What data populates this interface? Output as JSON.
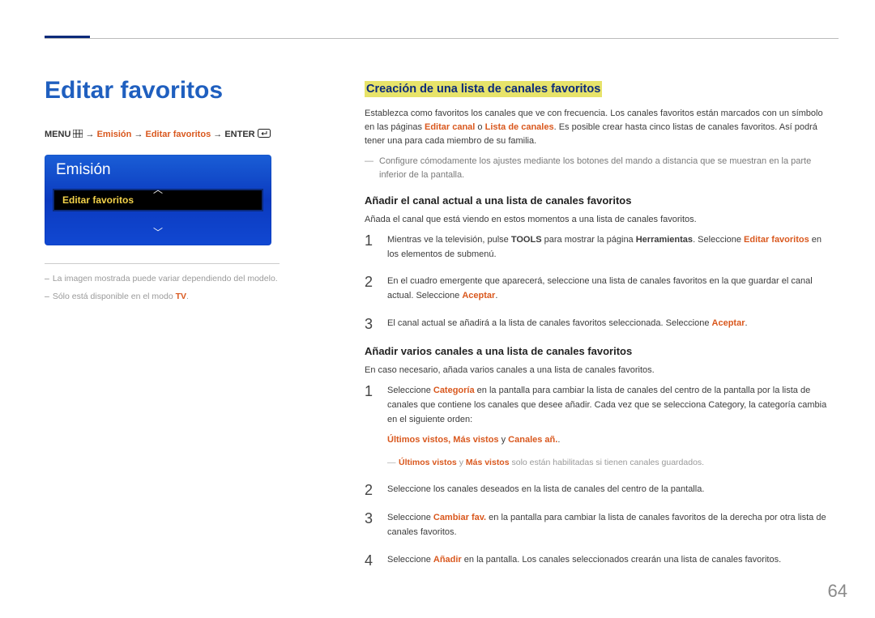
{
  "page_number": "64",
  "left": {
    "title": "Editar favoritos",
    "breadcrumb": {
      "menu": "MENU",
      "arrow": "→",
      "part1": "Emisión",
      "part2": "Editar favoritos",
      "enter": "ENTER"
    },
    "panel": {
      "header": "Emisión",
      "selected": "Editar favoritos"
    },
    "footnotes": [
      {
        "text": "La imagen mostrada puede variar dependiendo del modelo."
      },
      {
        "pre": "Sólo está disponible en el modo ",
        "hl": "TV",
        "post": "."
      }
    ]
  },
  "right": {
    "section_title": "Creación de una lista de canales favoritos",
    "intro": {
      "pre": "Establezca como favoritos los canales que ve con frecuencia. Los canales favoritos están marcados con un símbolo en las páginas ",
      "hl1": "Editar canal",
      "mid1": " o ",
      "hl2": "Lista de canales",
      "post": ". Es posible crear hasta cinco listas de canales favoritos. Así podrá tener una para cada miembro de su familia."
    },
    "tip1": "Configure cómodamente los ajustes mediante los botones del mando a distancia que se muestran en la parte inferior de la pantalla.",
    "sub1": {
      "title": "Añadir el canal actual a una lista de canales favoritos",
      "lead": "Añada el canal que está viendo en estos momentos a una lista de canales favoritos.",
      "steps": [
        {
          "pre": "Mientras ve la televisión, pulse ",
          "b1": "TOOLS",
          "mid": " para mostrar la página ",
          "b2": "Herramientas",
          "mid2": ". Seleccione ",
          "hl": "Editar favoritos",
          "post": " en los elementos de submenú."
        },
        {
          "pre": "En el cuadro emergente que aparecerá, seleccione una lista de canales favoritos en la que guardar el canal actual. Seleccione ",
          "hl": "Aceptar",
          "post": "."
        },
        {
          "pre": "El canal actual se añadirá a la lista de canales favoritos seleccionada. Seleccione ",
          "hl": "Aceptar",
          "post": "."
        }
      ]
    },
    "sub2": {
      "title": "Añadir varios canales a una lista de canales favoritos",
      "lead": "En caso necesario, añada varios canales a una lista de canales favoritos.",
      "steps": [
        {
          "pre": "Seleccione ",
          "hl": "Categoría",
          "mid": " en la pantalla para cambiar la lista de canales del centro de la pantalla por la lista de canales que contiene los canales que desee añadir. Cada vez que se selecciona Category, la categoría cambia en el siguiente orden:",
          "trail_hl": "Últimos vistos, Más vistos",
          "trail_mid": " y ",
          "trail_hl2": "Canales añ.",
          "trail_post": ".",
          "note_hl": "Últimos vistos",
          "note_mid": " y ",
          "note_hl2": "Más vistos",
          "note_post": " solo están habilitadas si tienen canales guardados."
        },
        {
          "pre": "Seleccione los canales deseados en la lista de canales del centro de la pantalla."
        },
        {
          "pre": "Seleccione ",
          "hl": "Cambiar fav.",
          "post": " en la pantalla para cambiar la lista de canales favoritos de la derecha por otra lista de canales favoritos."
        },
        {
          "pre": "Seleccione ",
          "hl": "Añadir",
          "post": " en la pantalla. Los canales seleccionados crearán una lista de canales favoritos."
        }
      ]
    }
  }
}
